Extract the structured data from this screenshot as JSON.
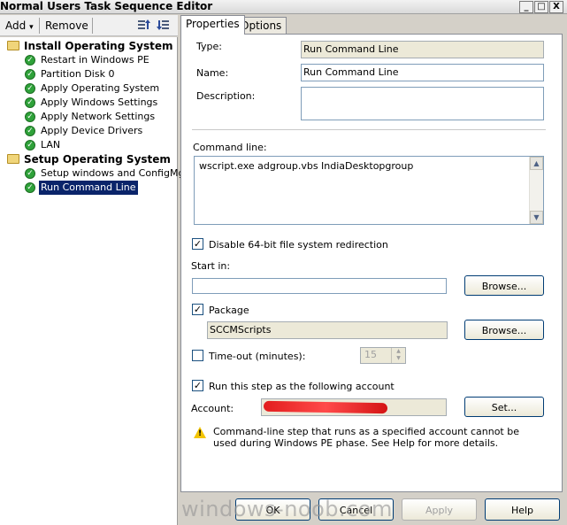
{
  "window": {
    "title": "Normal Users Task Sequence Editor",
    "minimize": "_",
    "maximize": "□",
    "close": "X"
  },
  "toolbar": {
    "add_label": "Add",
    "add_arrow": "▾",
    "remove_label": "Remove"
  },
  "tree": {
    "groups": [
      {
        "label": "Install Operating System",
        "items": [
          "Restart in Windows PE",
          "Partition Disk 0",
          "Apply Operating System",
          "Apply Windows Settings",
          "Apply Network Settings",
          "Apply Device Drivers",
          "LAN"
        ]
      },
      {
        "label": "Setup Operating System",
        "items": [
          "Setup windows and ConfigMgr",
          "Run Command Line"
        ]
      }
    ],
    "selected": "Run Command Line"
  },
  "tabs": [
    "Properties",
    "Options"
  ],
  "properties": {
    "type_label": "Type:",
    "type_value": "Run Command Line",
    "name_label": "Name:",
    "name_value": "Run Command Line",
    "description_label": "Description:",
    "description_value": "",
    "command_label": "Command line:",
    "command_value": "wscript.exe adgroup.vbs IndiaDesktopgroup",
    "disable64_label": "Disable 64-bit file system redirection",
    "disable64_checked": true,
    "startin_label": "Start in:",
    "startin_value": "",
    "browse_label": "Browse...",
    "package_label": "Package",
    "package_checked": true,
    "package_value": "SCCMScripts",
    "timeout_label": "Time-out (minutes):",
    "timeout_checked": false,
    "timeout_value": "15",
    "runas_label": "Run this step as the following account",
    "runas_checked": true,
    "account_label": "Account:",
    "set_label": "Set...",
    "warning_text": "Command-line step that runs as a specified account cannot be used during Windows PE phase. See Help for more details."
  },
  "footer": {
    "ok": "OK",
    "cancel": "Cancel",
    "apply": "Apply",
    "help": "Help"
  },
  "watermark": "windows-noob.com",
  "glyphs": {
    "check": "✓",
    "checkbox_tick": "✓",
    "up": "▲",
    "down": "▼",
    "warn": "!"
  }
}
